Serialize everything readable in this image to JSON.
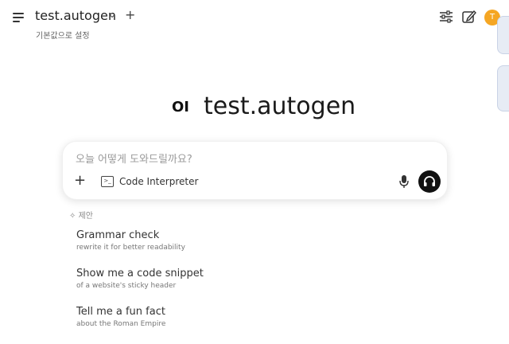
{
  "header": {
    "model_name": "test.autogen",
    "subtitle": "기본값으로 설정",
    "avatar_letter": "T"
  },
  "hero": {
    "logo_text": "OI",
    "title": "test.autogen"
  },
  "chat": {
    "placeholder": "오늘 어떻게 도와드릴까요?",
    "tool_label": "Code Interpreter"
  },
  "suggestions": {
    "label": "제안",
    "items": [
      {
        "title": "Grammar check",
        "subtitle": "rewrite it for better readability"
      },
      {
        "title": "Show me a code snippet",
        "subtitle": "of a website's sticky header"
      },
      {
        "title": "Tell me a fun fact",
        "subtitle": "about the Roman Empire"
      }
    ]
  },
  "colors": {
    "avatar": "#f5a623",
    "voice_button": "#111111",
    "side_card": "#e7ecf5"
  }
}
